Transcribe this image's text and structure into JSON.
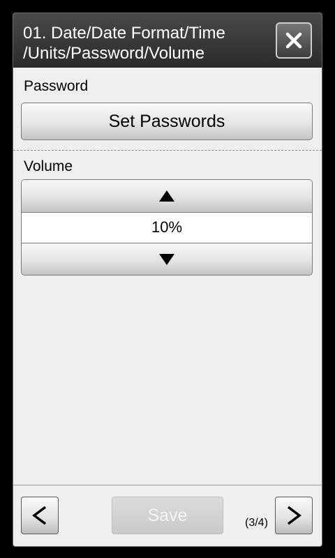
{
  "header": {
    "title": "01. Date/Date Format/Time\n/Units/Password/Volume",
    "close_icon": "close-icon"
  },
  "password_section": {
    "label": "Password",
    "button_label": "Set Passwords"
  },
  "volume_section": {
    "label": "Volume",
    "value": "10%",
    "up_icon": "triangle-up-icon",
    "down_icon": "triangle-down-icon",
    "level_percent": 10
  },
  "footer": {
    "prev_icon": "chevron-left-icon",
    "save_label": "Save",
    "save_enabled": false,
    "page_indicator": "(3/4)",
    "next_icon": "chevron-right-icon"
  },
  "colors": {
    "header_bg": "#2f2f2f",
    "panel_bg": "#efefef",
    "disabled_text": "#f4f4f4"
  }
}
